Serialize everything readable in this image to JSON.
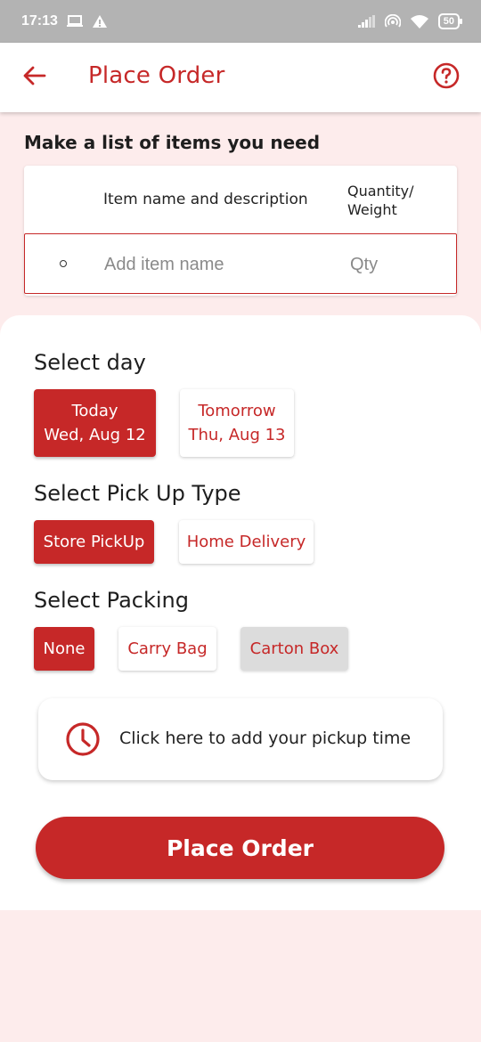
{
  "status_bar": {
    "time": "17:13",
    "battery": "50",
    "icons": [
      "screen-cast-icon",
      "warning-icon",
      "signal-icon",
      "hotspot-icon",
      "wifi-icon",
      "battery-icon"
    ]
  },
  "app_bar": {
    "title": "Place Order",
    "back_icon": "arrow-left-icon",
    "help_icon": "help-circle-icon"
  },
  "items": {
    "heading": "Make a list of items you need",
    "col_name": "Item name and description",
    "col_qty": "Quantity/ Weight",
    "name_placeholder": "Add item name",
    "qty_placeholder": "Qty"
  },
  "select_day": {
    "title": "Select day",
    "options": [
      {
        "line1": "Today",
        "line2": "Wed, Aug 12",
        "state": "selected"
      },
      {
        "line1": "Tomorrow",
        "line2": "Thu, Aug 13",
        "state": "unselected"
      }
    ]
  },
  "pickup_type": {
    "title": "Select Pick Up Type",
    "options": [
      {
        "label": "Store PickUp",
        "state": "selected"
      },
      {
        "label": "Home Delivery",
        "state": "unselected"
      }
    ]
  },
  "packing": {
    "title": "Select Packing",
    "options": [
      {
        "label": "None",
        "state": "selected"
      },
      {
        "label": "Carry Bag",
        "state": "unselected"
      },
      {
        "label": "Carton Box",
        "state": "disabled"
      }
    ]
  },
  "pickup_time": {
    "label": "Click here to add your pickup time",
    "icon": "clock-icon"
  },
  "place_order_button": "Place Order",
  "colors": {
    "accent": "#c62828",
    "background": "#fdecec",
    "status_bar": "#b3b3b3"
  }
}
